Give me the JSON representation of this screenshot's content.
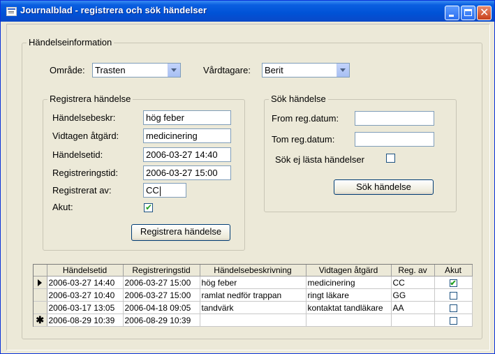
{
  "window": {
    "title": "Journalblad - registrera och sök händelser"
  },
  "event_info": {
    "legend": "Händelseinformation",
    "area_label": "Område:",
    "area_value": "Trasten",
    "patient_label": "Vårdtagare:",
    "patient_value": "Berit"
  },
  "register": {
    "legend": "Registrera händelse",
    "desc_label": "Händelsebeskr:",
    "desc_value": "hög feber",
    "action_label": "Vidtagen åtgärd:",
    "action_value": "medicinering",
    "eventtime_label": "Händelsetid:",
    "eventtime_value": "2006-03-27 14:40",
    "regtime_label": "Registreringstid:",
    "regtime_value": "2006-03-27 15:00",
    "regby_label": "Registrerat av:",
    "regby_value": "CC",
    "urgent_label": "Akut:",
    "urgent_checked": true,
    "button_label": "Registrera händelse"
  },
  "search": {
    "legend": "Sök händelse",
    "from_label": "From reg.datum:",
    "from_value": "",
    "to_label": "Tom reg.datum:",
    "to_value": "",
    "unread_label": "Sök ej lästa händelser",
    "unread_checked": false,
    "button_label": "Sök händelse"
  },
  "grid": {
    "columns": [
      "Händelsetid",
      "Registreringstid",
      "Händelsebeskrivning",
      "Vidtagen åtgärd",
      "Reg. av",
      "Akut"
    ],
    "rows": [
      {
        "selector": "current",
        "cells": [
          "2006-03-27 14:40",
          "2006-03-27 15:00",
          "hög feber",
          "medicinering",
          "CC"
        ],
        "urgent": true
      },
      {
        "selector": "",
        "cells": [
          "2006-03-27 10:40",
          "2006-03-27 15:00",
          "ramlat nedför trappan",
          "ringt läkare",
          "GG"
        ],
        "urgent": false
      },
      {
        "selector": "",
        "cells": [
          "2006-03-17 13:05",
          "2006-04-18 09:05",
          "tandvärk",
          "kontaktat tandläkare",
          "AA"
        ],
        "urgent": false
      },
      {
        "selector": "new",
        "cells": [
          "2006-08-29 10:39",
          "2006-08-29 10:39",
          "",
          "",
          ""
        ],
        "urgent": false
      }
    ]
  }
}
